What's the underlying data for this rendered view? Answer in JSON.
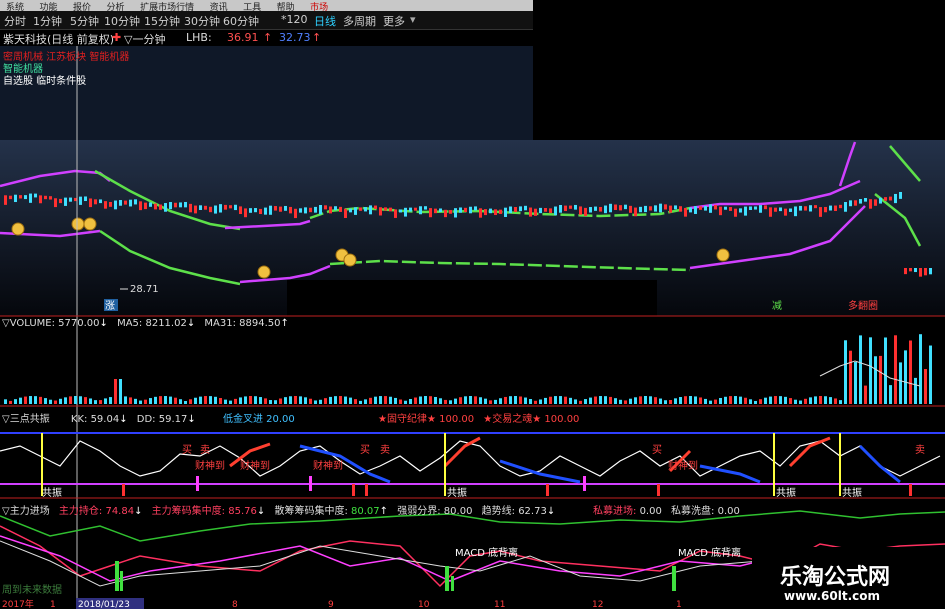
{
  "menu": {
    "items": [
      "系统",
      "功能",
      "报价",
      "分析",
      "扩展市场行情",
      "资讯",
      "工具",
      "帮助",
      "市场"
    ]
  },
  "toolbar": {
    "periods": [
      "分时",
      "1分钟",
      "5分钟",
      "10分钟",
      "15分钟",
      "30分钟",
      "60分钟",
      "*120",
      "日线",
      "多周期",
      "更多"
    ],
    "active": "日线"
  },
  "title": {
    "stock": "紫天科技(日线 前复权)",
    "marker": "▽一分钟",
    "lhb_label": "LHB:",
    "lhb_val1": "36.91",
    "lhb_val2": "32.73"
  },
  "overlay": {
    "line1": "密周机械 江苏板块 智能机器",
    "line2": "智能机器",
    "line3": "自选股 临时条件股"
  },
  "price_chart": {
    "low_label": "28.71",
    "tag_left": "涨",
    "tag_right1": "减",
    "tag_right2": "多翻圈"
  },
  "volume_panel": {
    "name": "VOLUME:",
    "vol": "5770.00",
    "ma5_label": "MA5:",
    "ma5": "8211.02",
    "ma31_label": "MA31:",
    "ma31": "8894.50"
  },
  "sandian_panel": {
    "name": "三点共振",
    "kk_label": "KK:",
    "kk": "59.04",
    "dd_label": "DD:",
    "dd": "59.17",
    "jc_label": "低金叉进",
    "jc_val": "20.00",
    "shbh_label": "★固守纪律★",
    "shbh_val": "100.00",
    "jy_label": "★交易之魂★",
    "jy_val": "100.00",
    "resonance": "共振",
    "buy": "买",
    "sell": "卖",
    "caishen": "财神到"
  },
  "zhuli_panel": {
    "name": "主力进场",
    "cc_label": "主力持仓:",
    "cc": "74.84",
    "cmj_label": "主力筹码集中度:",
    "cmj": "85.76",
    "sh_label": "散筹筹码集中度:",
    "sh": "80.07",
    "qr_label": "强弱分界:",
    "qr": "80.00",
    "qs_label": "趋势线:",
    "qs": "62.73",
    "sm_label": "私募进场:",
    "sm": "0.00",
    "xp_label": "私募洗盘:",
    "xp": "0.00",
    "macd1": "MACD 底背离",
    "macd2": "MACD 底背离",
    "bottom_text": "周到未来数据"
  },
  "dates": {
    "items": [
      "2017年",
      "1",
      "2018/01/23",
      "8",
      "9",
      "10",
      "11",
      "12",
      "1"
    ]
  },
  "watermark": {
    "line1": "乐淘公式网",
    "line2": "www.60lt.com"
  },
  "colors": {
    "active_period": "#2fd0ff",
    "band_magenta": "#d040ff",
    "band_green": "#5de04a",
    "candle_up": "#ff3030",
    "candle_down": "#40e0ff",
    "brand": "#e40000"
  }
}
